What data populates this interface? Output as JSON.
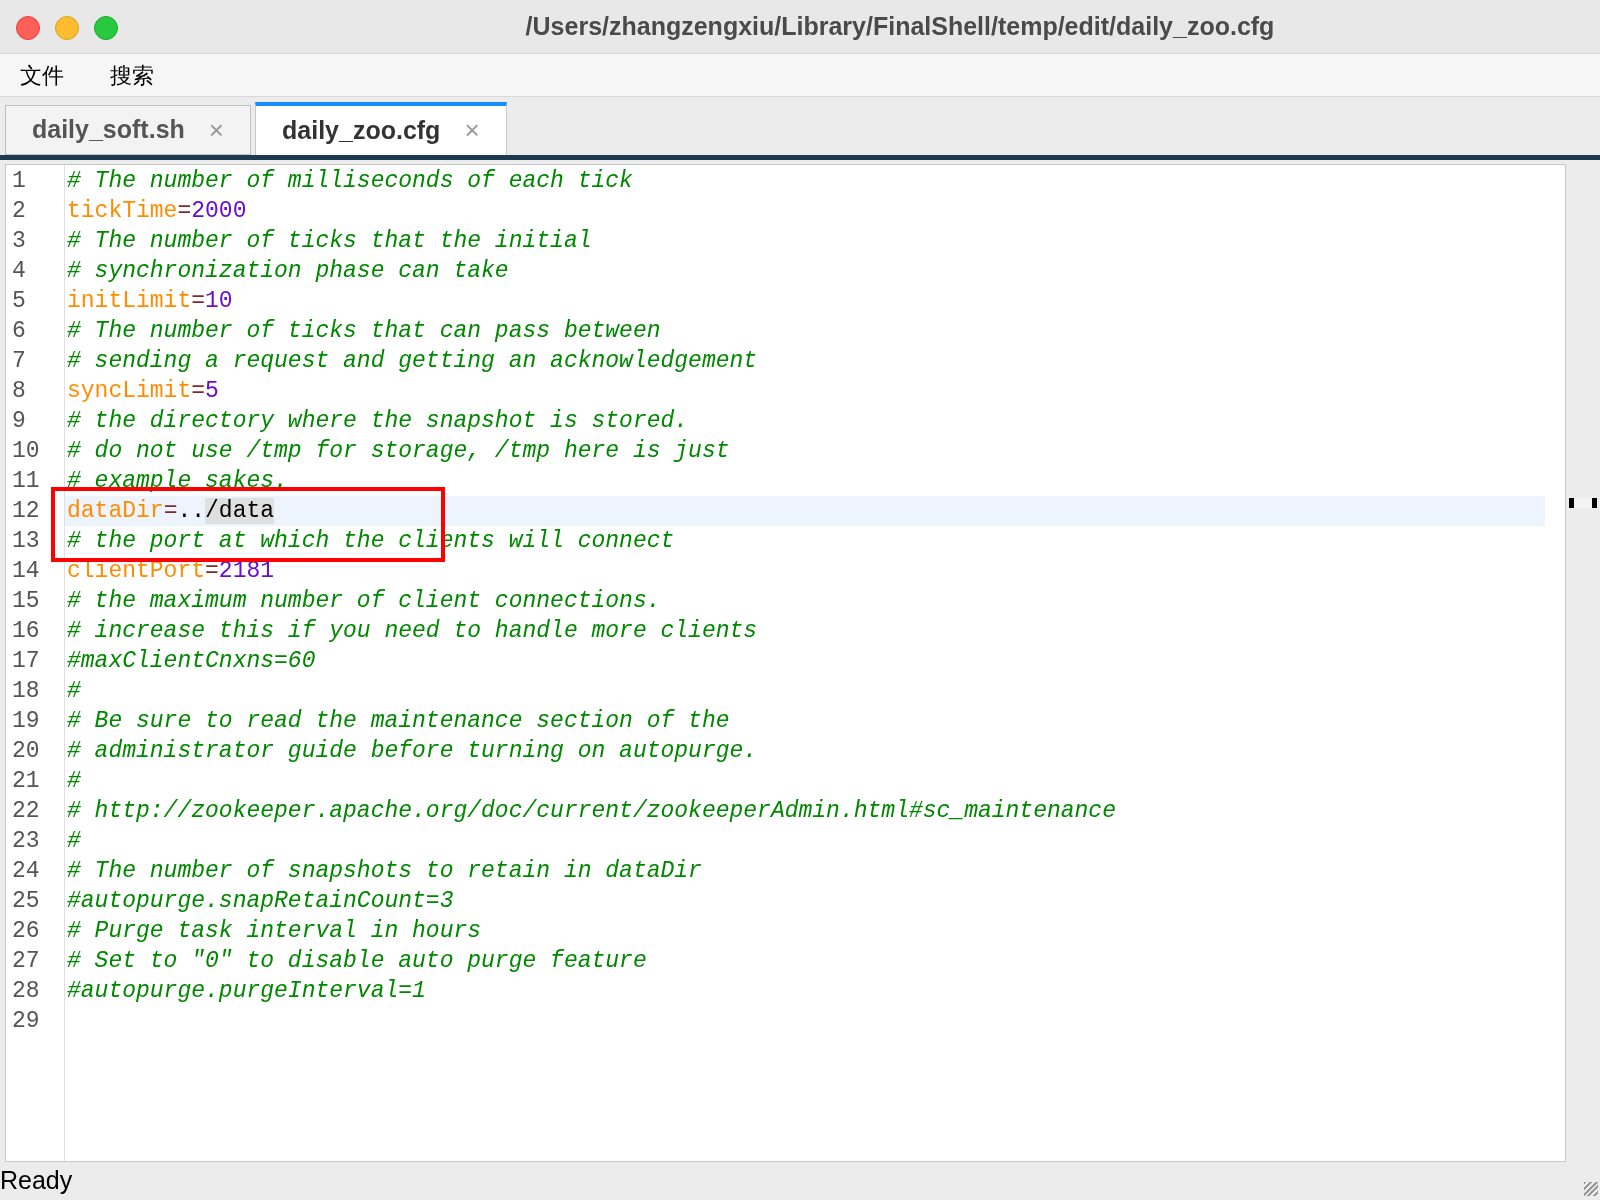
{
  "window": {
    "title": "/Users/zhangzengxiu/Library/FinalShell/temp/edit/daily_zoo.cfg"
  },
  "menu": [
    "文件",
    "搜索"
  ],
  "tabs": [
    {
      "label": "daily_soft.sh",
      "close": "×",
      "selected": false
    },
    {
      "label": "daily_zoo.cfg",
      "close": "×",
      "selected": true
    }
  ],
  "editor": {
    "lines": [
      {
        "number": "1",
        "current": false,
        "segments": [
          {
            "kind": "comment",
            "text": "# The number of milliseconds of each tick"
          }
        ]
      },
      {
        "number": "2",
        "current": false,
        "segments": [
          {
            "kind": "key",
            "text": "tickTime"
          },
          {
            "kind": "eq",
            "text": "="
          },
          {
            "kind": "value",
            "text": "2000"
          }
        ]
      },
      {
        "number": "3",
        "current": false,
        "segments": [
          {
            "kind": "comment",
            "text": "# The number of ticks that the initial"
          }
        ]
      },
      {
        "number": "4",
        "current": false,
        "segments": [
          {
            "kind": "comment",
            "text": "# synchronization phase can take"
          }
        ]
      },
      {
        "number": "5",
        "current": false,
        "segments": [
          {
            "kind": "key",
            "text": "initLimit"
          },
          {
            "kind": "eq",
            "text": "="
          },
          {
            "kind": "value",
            "text": "10"
          }
        ]
      },
      {
        "number": "6",
        "current": false,
        "segments": [
          {
            "kind": "comment",
            "text": "# The number of ticks that can pass between"
          }
        ]
      },
      {
        "number": "7",
        "current": false,
        "segments": [
          {
            "kind": "comment",
            "text": "# sending a request and getting an acknowledgement"
          }
        ]
      },
      {
        "number": "8",
        "current": false,
        "segments": [
          {
            "kind": "key",
            "text": "syncLimit"
          },
          {
            "kind": "eq",
            "text": "="
          },
          {
            "kind": "value",
            "text": "5"
          }
        ]
      },
      {
        "number": "9",
        "current": false,
        "segments": [
          {
            "kind": "comment",
            "text": "# the directory where the snapshot is stored."
          }
        ]
      },
      {
        "number": "10",
        "current": false,
        "segments": [
          {
            "kind": "comment",
            "text": "# do not use /tmp for storage, /tmp here is just"
          }
        ]
      },
      {
        "number": "11",
        "current": false,
        "segments": [
          {
            "kind": "comment",
            "text": "# example sakes."
          }
        ]
      },
      {
        "number": "12",
        "current": true,
        "segments": [
          {
            "kind": "key",
            "text": "dataDir"
          },
          {
            "kind": "eq",
            "text": "="
          },
          {
            "kind": "plain",
            "text": ".."
          },
          {
            "kind": "selection",
            "text": "/data"
          }
        ]
      },
      {
        "number": "13",
        "current": false,
        "segments": [
          {
            "kind": "comment",
            "text": "# the port at which the clients will connect"
          }
        ]
      },
      {
        "number": "14",
        "current": false,
        "segments": [
          {
            "kind": "key",
            "text": "clientPort"
          },
          {
            "kind": "eq",
            "text": "="
          },
          {
            "kind": "value",
            "text": "2181"
          }
        ]
      },
      {
        "number": "15",
        "current": false,
        "segments": [
          {
            "kind": "comment",
            "text": "# the maximum number of client connections."
          }
        ]
      },
      {
        "number": "16",
        "current": false,
        "segments": [
          {
            "kind": "comment",
            "text": "# increase this if you need to handle more clients"
          }
        ]
      },
      {
        "number": "17",
        "current": false,
        "segments": [
          {
            "kind": "comment",
            "text": "#maxClientCnxns=60"
          }
        ]
      },
      {
        "number": "18",
        "current": false,
        "segments": [
          {
            "kind": "comment",
            "text": "#"
          }
        ]
      },
      {
        "number": "19",
        "current": false,
        "segments": [
          {
            "kind": "comment",
            "text": "# Be sure to read the maintenance section of the"
          }
        ]
      },
      {
        "number": "20",
        "current": false,
        "segments": [
          {
            "kind": "comment",
            "text": "# administrator guide before turning on autopurge."
          }
        ]
      },
      {
        "number": "21",
        "current": false,
        "segments": [
          {
            "kind": "comment",
            "text": "#"
          }
        ]
      },
      {
        "number": "22",
        "current": false,
        "segments": [
          {
            "kind": "comment",
            "text": "# http://zookeeper.apache.org/doc/current/zookeeperAdmin.html#sc_maintenance"
          }
        ]
      },
      {
        "number": "23",
        "current": false,
        "segments": [
          {
            "kind": "comment",
            "text": "#"
          }
        ]
      },
      {
        "number": "24",
        "current": false,
        "segments": [
          {
            "kind": "comment",
            "text": "# The number of snapshots to retain in dataDir"
          }
        ]
      },
      {
        "number": "25",
        "current": false,
        "segments": [
          {
            "kind": "comment",
            "text": "#autopurge.snapRetainCount=3"
          }
        ]
      },
      {
        "number": "26",
        "current": false,
        "segments": [
          {
            "kind": "comment",
            "text": "# Purge task interval in hours"
          }
        ]
      },
      {
        "number": "27",
        "current": false,
        "segments": [
          {
            "kind": "comment",
            "text": "# Set to \"0\" to disable auto purge feature"
          }
        ]
      },
      {
        "number": "28",
        "current": false,
        "segments": [
          {
            "kind": "comment",
            "text": "#autopurge.purgeInterval=1"
          }
        ]
      },
      {
        "number": "29"
      }
    ]
  },
  "status_bar": {
    "text": "Ready"
  }
}
